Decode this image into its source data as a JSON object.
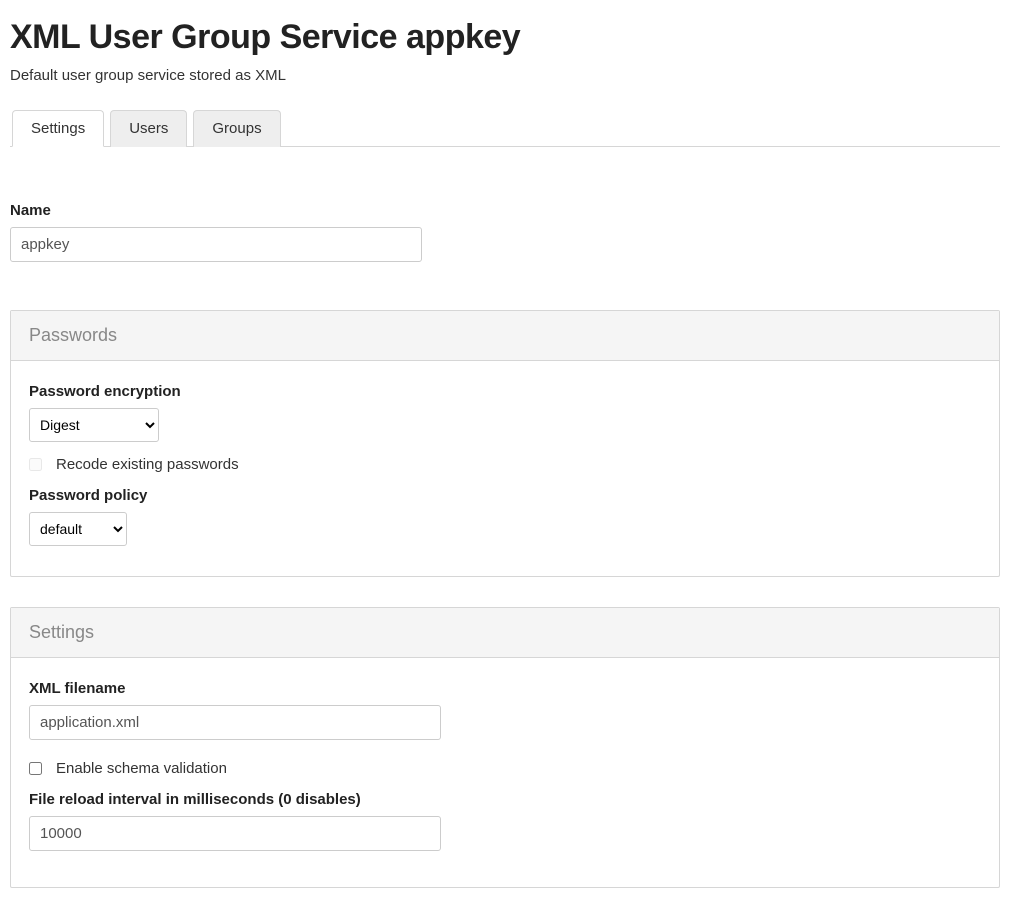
{
  "header": {
    "title": "XML User Group Service appkey",
    "subtitle": "Default user group service stored as XML"
  },
  "tabs": {
    "t0": "Settings",
    "t1": "Users",
    "t2": "Groups"
  },
  "nameField": {
    "label": "Name",
    "value": "appkey"
  },
  "passwords": {
    "panelTitle": "Passwords",
    "encryptionLabel": "Password encryption",
    "encryptionValue": "Digest",
    "recodeLabel": "Recode existing passwords",
    "recodeChecked": false,
    "policyLabel": "Password policy",
    "policyValue": "default"
  },
  "settings": {
    "panelTitle": "Settings",
    "filenameLabel": "XML filename",
    "filenameValue": "application.xml",
    "schemaLabel": "Enable schema validation",
    "schemaChecked": false,
    "reloadLabel": "File reload interval in milliseconds (0 disables)",
    "reloadValue": "10000"
  }
}
